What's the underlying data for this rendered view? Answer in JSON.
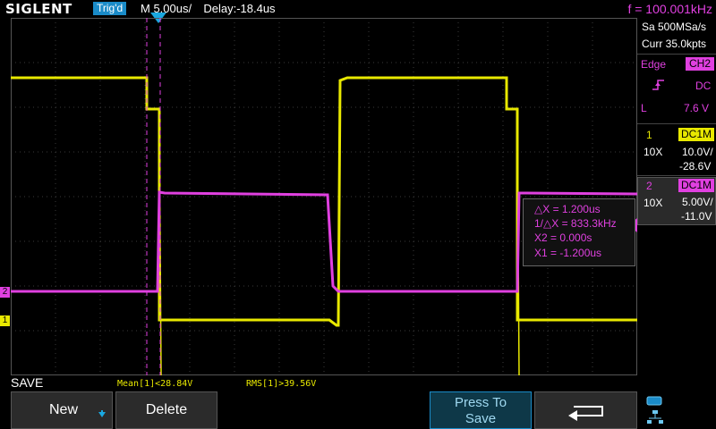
{
  "header": {
    "brand": "SIGLENT",
    "trigger_status": "Trig'd",
    "timebase": "M 5.00us/",
    "delay": "Delay:-18.4us",
    "frequency": "f = 100.001kHz"
  },
  "acquisition": {
    "sample_rate": "Sa 500MSa/s",
    "memory": "Curr 35.0kpts"
  },
  "trigger": {
    "type": "Edge",
    "source": "CH2",
    "coupling": "DC",
    "level_label": "L",
    "level": "7.6 V"
  },
  "channels": [
    {
      "number": "1",
      "coupling": "DC1M",
      "probe": "10X",
      "scale": "10.0V/",
      "offset": "-28.6V",
      "color": "#e8e800"
    },
    {
      "number": "2",
      "coupling": "DC1M",
      "probe": "10X",
      "scale": "5.00V/",
      "offset": "-11.0V",
      "color": "#e040e0"
    }
  ],
  "cursor": {
    "delta_x": "△X = 1.200us",
    "inv_delta_x": "1/△X = 833.3kHz",
    "x2": "X2 = 0.000s",
    "x1": "X1 = -1.200us"
  },
  "measurements": {
    "mean": "Mean[1]<28.84V",
    "rms": "RMS[1]>39.56V"
  },
  "menu": {
    "title": "SAVE",
    "new_label": "New",
    "delete_label": "Delete",
    "press_line1": "Press To",
    "press_line2": "Save"
  },
  "colors": {
    "ch1": "#e8e800",
    "ch2": "#e040e0",
    "accent": "#1a8bc8",
    "grid": "#3a3a3a"
  }
}
